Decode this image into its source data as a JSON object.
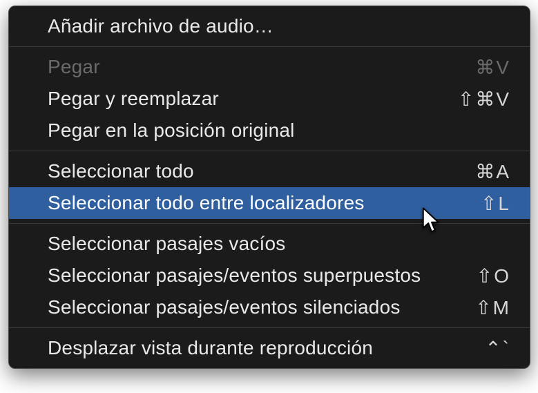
{
  "menu": {
    "sections": [
      {
        "items": [
          {
            "id": "add-audio-file",
            "label": "Añadir archivo de audio…",
            "shortcut": "",
            "disabled": false
          }
        ]
      },
      {
        "items": [
          {
            "id": "paste",
            "label": "Pegar",
            "shortcut": "⌘V",
            "disabled": true
          },
          {
            "id": "paste-replace",
            "label": "Pegar y reemplazar",
            "shortcut": "⇧⌘V",
            "disabled": false
          },
          {
            "id": "paste-original-position",
            "label": "Pegar en la posición original",
            "shortcut": "",
            "disabled": false
          }
        ]
      },
      {
        "items": [
          {
            "id": "select-all",
            "label": "Seleccionar todo",
            "shortcut": "⌘A",
            "disabled": false
          },
          {
            "id": "select-all-between-locators",
            "label": "Seleccionar todo entre localizadores",
            "shortcut": "⇧L",
            "disabled": false,
            "highlight": true
          }
        ]
      },
      {
        "items": [
          {
            "id": "select-empty-passages",
            "label": "Seleccionar pasajes vacíos",
            "shortcut": "",
            "disabled": false
          },
          {
            "id": "select-overlapped",
            "label": "Seleccionar pasajes/eventos superpuestos",
            "shortcut": "⇧O",
            "disabled": false
          },
          {
            "id": "select-muted",
            "label": "Seleccionar pasajes/eventos silenciados",
            "shortcut": "⇧M",
            "disabled": false
          }
        ]
      },
      {
        "items": [
          {
            "id": "scroll-view-playback",
            "label": "Desplazar vista durante reproducción",
            "shortcut": "⌃`",
            "disabled": false
          }
        ]
      }
    ]
  }
}
